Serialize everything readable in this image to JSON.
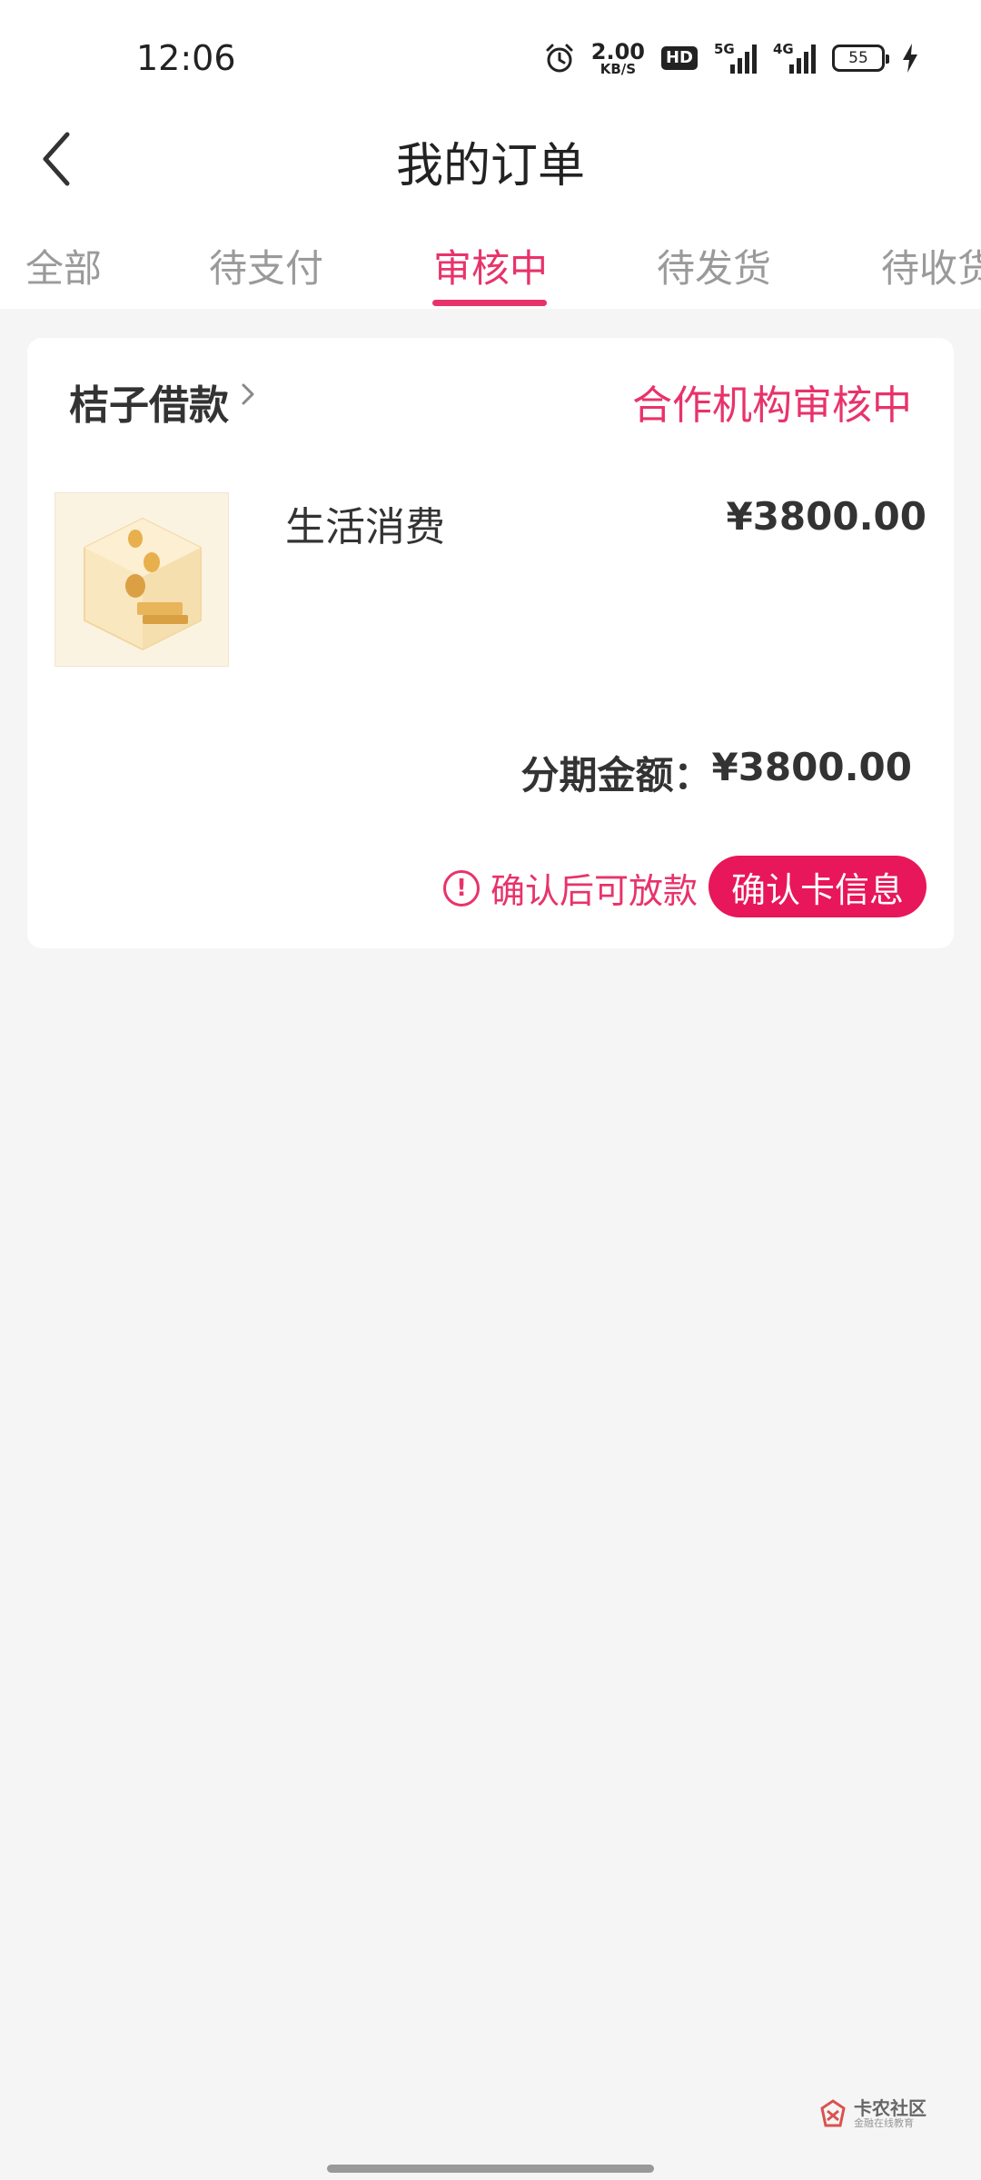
{
  "status_bar": {
    "time": "12:06",
    "net_speed_value": "2.00",
    "net_speed_unit": "KB/S",
    "hd_badge": "HD",
    "signal1_label": "5G",
    "signal2_label": "4G",
    "battery_level": "55"
  },
  "header": {
    "title": "我的订单"
  },
  "tabs": [
    {
      "label": "全部",
      "active": false
    },
    {
      "label": "待支付",
      "active": false
    },
    {
      "label": "审核中",
      "active": true
    },
    {
      "label": "待发货",
      "active": false
    },
    {
      "label": "待收货",
      "active": false
    }
  ],
  "order": {
    "merchant": "桔子借款",
    "status": "合作机构审核中",
    "product_name": "生活消费",
    "product_price": "¥3800.00",
    "installment_label": "分期金额：",
    "installment_amount": "¥3800.00",
    "notice": "确认后可放款",
    "action_button": "确认卡信息"
  },
  "watermark": {
    "main": "卡农社区",
    "sub": "金融在线教育"
  },
  "colors": {
    "accent": "#e8336a",
    "button": "#e8165a",
    "background": "#f5f5f5"
  }
}
